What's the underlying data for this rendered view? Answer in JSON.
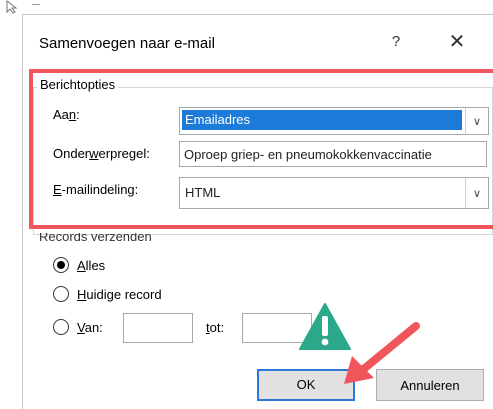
{
  "dialog": {
    "title": "Samenvoegen naar e-mail",
    "help_label": "?",
    "close_label": "✕"
  },
  "message_options": {
    "legend": "Berichtopties",
    "to": {
      "label_pre": "Aa",
      "label_mnemonic": "n",
      "label_post": ":",
      "value": "Emailadres"
    },
    "subject": {
      "label_pre": "Onder",
      "label_mnemonic": "w",
      "label_post": "erpregel:",
      "value": "Oproep griep- en pneumokokkenvaccinatie"
    },
    "format": {
      "label_pre": "",
      "label_mnemonic": "E",
      "label_post": "-mailindeling:",
      "value": "HTML"
    }
  },
  "send_records": {
    "legend": "Records verzenden",
    "all": {
      "mnemonic": "A",
      "rest": "lles",
      "checked": true
    },
    "current": {
      "mnemonic": "H",
      "rest": "uidige record",
      "checked": false
    },
    "from": {
      "mnemonic": "V",
      "rest": "an:",
      "checked": false
    },
    "to_label_mnemonic": "t",
    "to_label_rest": "ot:"
  },
  "buttons": {
    "ok": "OK",
    "cancel": "Annuleren"
  },
  "colors": {
    "highlight": "#f0555b",
    "selection": "#1c7ad9",
    "warning": "#2aa889"
  },
  "icons": [
    "cursor-icon",
    "help-icon",
    "close-icon",
    "chevron-down-icon",
    "warning-icon",
    "arrow-pointer-icon"
  ]
}
